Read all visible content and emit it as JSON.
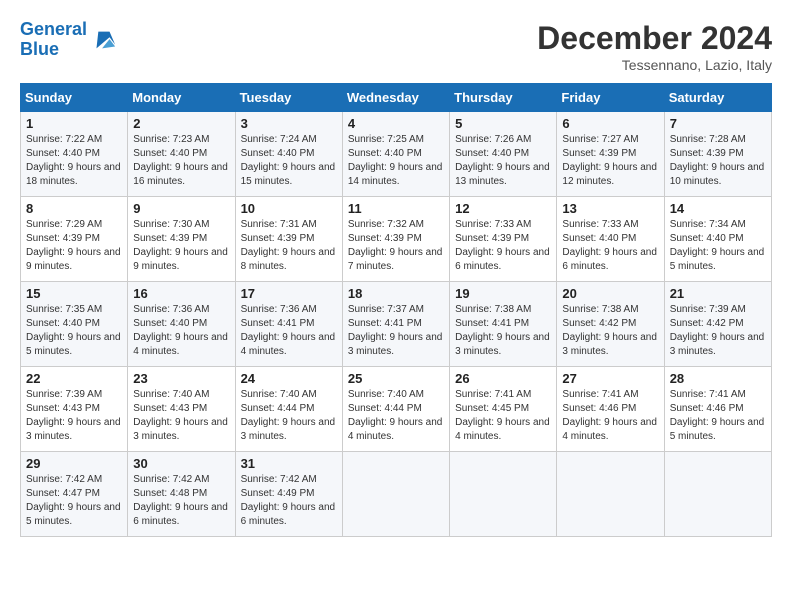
{
  "header": {
    "logo_line1": "General",
    "logo_line2": "Blue",
    "month": "December 2024",
    "location": "Tessennano, Lazio, Italy"
  },
  "weekdays": [
    "Sunday",
    "Monday",
    "Tuesday",
    "Wednesday",
    "Thursday",
    "Friday",
    "Saturday"
  ],
  "weeks": [
    [
      {
        "day": "1",
        "sunrise": "7:22 AM",
        "sunset": "4:40 PM",
        "daylight": "9 hours and 18 minutes."
      },
      {
        "day": "2",
        "sunrise": "7:23 AM",
        "sunset": "4:40 PM",
        "daylight": "9 hours and 16 minutes."
      },
      {
        "day": "3",
        "sunrise": "7:24 AM",
        "sunset": "4:40 PM",
        "daylight": "9 hours and 15 minutes."
      },
      {
        "day": "4",
        "sunrise": "7:25 AM",
        "sunset": "4:40 PM",
        "daylight": "9 hours and 14 minutes."
      },
      {
        "day": "5",
        "sunrise": "7:26 AM",
        "sunset": "4:40 PM",
        "daylight": "9 hours and 13 minutes."
      },
      {
        "day": "6",
        "sunrise": "7:27 AM",
        "sunset": "4:39 PM",
        "daylight": "9 hours and 12 minutes."
      },
      {
        "day": "7",
        "sunrise": "7:28 AM",
        "sunset": "4:39 PM",
        "daylight": "9 hours and 10 minutes."
      }
    ],
    [
      {
        "day": "8",
        "sunrise": "7:29 AM",
        "sunset": "4:39 PM",
        "daylight": "9 hours and 9 minutes."
      },
      {
        "day": "9",
        "sunrise": "7:30 AM",
        "sunset": "4:39 PM",
        "daylight": "9 hours and 9 minutes."
      },
      {
        "day": "10",
        "sunrise": "7:31 AM",
        "sunset": "4:39 PM",
        "daylight": "9 hours and 8 minutes."
      },
      {
        "day": "11",
        "sunrise": "7:32 AM",
        "sunset": "4:39 PM",
        "daylight": "9 hours and 7 minutes."
      },
      {
        "day": "12",
        "sunrise": "7:33 AM",
        "sunset": "4:39 PM",
        "daylight": "9 hours and 6 minutes."
      },
      {
        "day": "13",
        "sunrise": "7:33 AM",
        "sunset": "4:40 PM",
        "daylight": "9 hours and 6 minutes."
      },
      {
        "day": "14",
        "sunrise": "7:34 AM",
        "sunset": "4:40 PM",
        "daylight": "9 hours and 5 minutes."
      }
    ],
    [
      {
        "day": "15",
        "sunrise": "7:35 AM",
        "sunset": "4:40 PM",
        "daylight": "9 hours and 5 minutes."
      },
      {
        "day": "16",
        "sunrise": "7:36 AM",
        "sunset": "4:40 PM",
        "daylight": "9 hours and 4 minutes."
      },
      {
        "day": "17",
        "sunrise": "7:36 AM",
        "sunset": "4:41 PM",
        "daylight": "9 hours and 4 minutes."
      },
      {
        "day": "18",
        "sunrise": "7:37 AM",
        "sunset": "4:41 PM",
        "daylight": "9 hours and 3 minutes."
      },
      {
        "day": "19",
        "sunrise": "7:38 AM",
        "sunset": "4:41 PM",
        "daylight": "9 hours and 3 minutes."
      },
      {
        "day": "20",
        "sunrise": "7:38 AM",
        "sunset": "4:42 PM",
        "daylight": "9 hours and 3 minutes."
      },
      {
        "day": "21",
        "sunrise": "7:39 AM",
        "sunset": "4:42 PM",
        "daylight": "9 hours and 3 minutes."
      }
    ],
    [
      {
        "day": "22",
        "sunrise": "7:39 AM",
        "sunset": "4:43 PM",
        "daylight": "9 hours and 3 minutes."
      },
      {
        "day": "23",
        "sunrise": "7:40 AM",
        "sunset": "4:43 PM",
        "daylight": "9 hours and 3 minutes."
      },
      {
        "day": "24",
        "sunrise": "7:40 AM",
        "sunset": "4:44 PM",
        "daylight": "9 hours and 3 minutes."
      },
      {
        "day": "25",
        "sunrise": "7:40 AM",
        "sunset": "4:44 PM",
        "daylight": "9 hours and 4 minutes."
      },
      {
        "day": "26",
        "sunrise": "7:41 AM",
        "sunset": "4:45 PM",
        "daylight": "9 hours and 4 minutes."
      },
      {
        "day": "27",
        "sunrise": "7:41 AM",
        "sunset": "4:46 PM",
        "daylight": "9 hours and 4 minutes."
      },
      {
        "day": "28",
        "sunrise": "7:41 AM",
        "sunset": "4:46 PM",
        "daylight": "9 hours and 5 minutes."
      }
    ],
    [
      {
        "day": "29",
        "sunrise": "7:42 AM",
        "sunset": "4:47 PM",
        "daylight": "9 hours and 5 minutes."
      },
      {
        "day": "30",
        "sunrise": "7:42 AM",
        "sunset": "4:48 PM",
        "daylight": "9 hours and 6 minutes."
      },
      {
        "day": "31",
        "sunrise": "7:42 AM",
        "sunset": "4:49 PM",
        "daylight": "9 hours and 6 minutes."
      },
      null,
      null,
      null,
      null
    ]
  ],
  "labels": {
    "sunrise": "Sunrise:",
    "sunset": "Sunset:",
    "daylight": "Daylight:"
  }
}
